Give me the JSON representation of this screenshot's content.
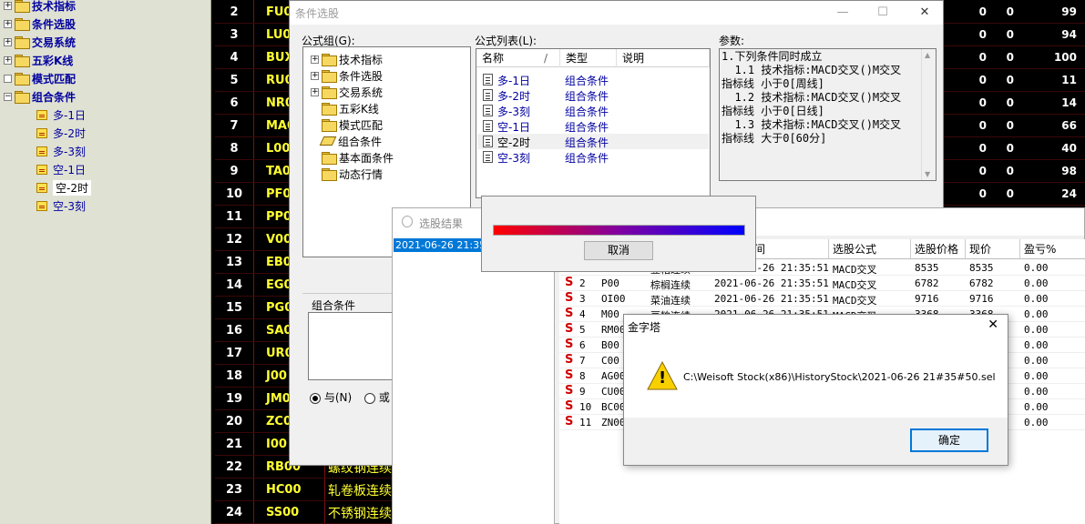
{
  "left_tree": {
    "items": [
      {
        "label": "技术指标",
        "type": "folder",
        "expander": "+"
      },
      {
        "label": "条件选股",
        "type": "folder",
        "expander": "+"
      },
      {
        "label": "交易系统",
        "type": "folder",
        "expander": "+"
      },
      {
        "label": "五彩K线",
        "type": "folder",
        "expander": "+"
      },
      {
        "label": "模式匹配",
        "type": "folder",
        "expander": ""
      },
      {
        "label": "组合条件",
        "type": "folder",
        "expander": "−"
      },
      {
        "label": "多-1日",
        "type": "leaf"
      },
      {
        "label": "多-2时",
        "type": "leaf"
      },
      {
        "label": "多-3刻",
        "type": "leaf"
      },
      {
        "label": "空-1日",
        "type": "leaf"
      },
      {
        "label": "空-2时",
        "type": "leaf",
        "selected": true
      },
      {
        "label": "空-3刻",
        "type": "leaf"
      }
    ]
  },
  "quote_table": {
    "rows": [
      {
        "num": "2",
        "code": "FU0",
        "name": "",
        "c1": "0",
        "c2": "0",
        "c3": "99"
      },
      {
        "num": "3",
        "code": "LU0",
        "name": "",
        "c1": "0",
        "c2": "0",
        "c3": "94"
      },
      {
        "num": "4",
        "code": "BUX",
        "name": "",
        "c1": "0",
        "c2": "0",
        "c3": "100"
      },
      {
        "num": "5",
        "code": "RU0",
        "name": "",
        "c1": "0",
        "c2": "0",
        "c3": "11"
      },
      {
        "num": "6",
        "code": "NR0",
        "name": "",
        "c1": "0",
        "c2": "0",
        "c3": "14"
      },
      {
        "num": "7",
        "code": "MA0",
        "name": "",
        "c1": "0",
        "c2": "0",
        "c3": "66"
      },
      {
        "num": "8",
        "code": "L00",
        "name": "",
        "c1": "0",
        "c2": "0",
        "c3": "40"
      },
      {
        "num": "9",
        "code": "TA00",
        "name": "",
        "c1": "0",
        "c2": "0",
        "c3": "98"
      },
      {
        "num": "10",
        "code": "PF00",
        "name": "",
        "c1": "0",
        "c2": "0",
        "c3": "24"
      },
      {
        "num": "11",
        "code": "PP0",
        "name": "",
        "c1": "",
        "c2": "",
        "c3": ""
      },
      {
        "num": "12",
        "code": "V00",
        "name": "",
        "c1": "",
        "c2": "",
        "c3": ""
      },
      {
        "num": "13",
        "code": "EB0",
        "name": "",
        "c1": "",
        "c2": "",
        "c3": ""
      },
      {
        "num": "14",
        "code": "EG0",
        "name": "",
        "c1": "",
        "c2": "",
        "c3": ""
      },
      {
        "num": "15",
        "code": "PG0",
        "name": "",
        "c1": "",
        "c2": "",
        "c3": ""
      },
      {
        "num": "16",
        "code": "SA0",
        "name": "",
        "c1": "",
        "c2": "",
        "c3": ""
      },
      {
        "num": "17",
        "code": "UR0",
        "name": "",
        "c1": "",
        "c2": "",
        "c3": ""
      },
      {
        "num": "18",
        "code": "J00",
        "name": "",
        "c1": "",
        "c2": "",
        "c3": ""
      },
      {
        "num": "19",
        "code": "JM0",
        "name": "",
        "c1": "",
        "c2": "",
        "c3": ""
      },
      {
        "num": "20",
        "code": "ZC0",
        "name": "",
        "c1": "",
        "c2": "",
        "c3": ""
      },
      {
        "num": "21",
        "code": "I00",
        "name": "",
        "c1": "",
        "c2": "",
        "c3": ""
      },
      {
        "num": "22",
        "code": "RB00",
        "name": "螺纹钢连续",
        "c1": "",
        "c2": "",
        "c3": ""
      },
      {
        "num": "23",
        "code": "HC00",
        "name": "轧卷板连续",
        "c1": "",
        "c2": "",
        "c3": ""
      },
      {
        "num": "24",
        "code": "SS00",
        "name": "不锈钢连续",
        "c1": "",
        "c2": "",
        "c3": ""
      }
    ]
  },
  "cond_window": {
    "title": "条件选股",
    "min_btn": "—",
    "max_btn": "☐",
    "close_btn": "✕",
    "group_label": "公式组(G):",
    "group_tree": [
      {
        "label": "技术指标",
        "expander": "+",
        "icon": "folder"
      },
      {
        "label": "条件选股",
        "expander": "+",
        "icon": "folder"
      },
      {
        "label": "交易系统",
        "expander": "+",
        "icon": "folder"
      },
      {
        "label": "五彩K线",
        "expander": "",
        "icon": "folder"
      },
      {
        "label": "模式匹配",
        "expander": "",
        "icon": "folder"
      },
      {
        "label": "组合条件",
        "expander": "",
        "icon": "pencil"
      },
      {
        "label": "基本面条件",
        "expander": "",
        "icon": "folder"
      },
      {
        "label": "动态行情",
        "expander": "",
        "icon": "folder"
      }
    ],
    "formula_label": "公式列表(L):",
    "formula_headers": {
      "name": "名称",
      "sort": "/",
      "type": "类型",
      "desc": "说明"
    },
    "formulas": [
      {
        "name": "多-1日",
        "type": "组合条件"
      },
      {
        "name": "多-2时",
        "type": "组合条件"
      },
      {
        "name": "多-3刻",
        "type": "组合条件"
      },
      {
        "name": "空-1日",
        "type": "组合条件"
      },
      {
        "name": "空-2时",
        "type": "组合条件",
        "selected": true
      },
      {
        "name": "空-3刻",
        "type": "组合条件"
      }
    ],
    "params_label": "参数:",
    "params_lines": [
      "1.下列条件同时成立",
      "  1.1 技术指标:MACD交叉()M交叉",
      "指标线 小于0[周线]",
      "  1.2 技术指标:MACD交叉()M交叉",
      "指标线 小于0[日线]",
      "  1.3 技术指标:MACD交叉()M交叉",
      "指标线 大于0[60分]"
    ],
    "combo_label": "组合条件",
    "radio_and": "与(N)",
    "radio_or": "或"
  },
  "result_window": {
    "title": "选股结果",
    "list_item": "2021-06-26 21:35",
    "headers": [
      "选股公式",
      "选股价格",
      "现价",
      "盈亏%"
    ],
    "header_partial": "间",
    "rows": [
      {
        "s": "S",
        "n": "",
        "code": "",
        "name": "豆粕连续",
        "time": "2021-06-26 21:35:51",
        "formula": "MACD交叉",
        "price": "8535",
        "cur": "8535",
        "pl": "0.00"
      },
      {
        "s": "S",
        "n": "2",
        "code": "P00",
        "name": "棕榈连续",
        "time": "2021-06-26 21:35:51",
        "formula": "MACD交叉",
        "price": "6782",
        "cur": "6782",
        "pl": "0.00"
      },
      {
        "s": "S",
        "n": "3",
        "code": "OI00",
        "name": "菜油连续",
        "time": "2021-06-26 21:35:51",
        "formula": "MACD交叉",
        "price": "9716",
        "cur": "9716",
        "pl": "0.00"
      },
      {
        "s": "S",
        "n": "4",
        "code": "M00",
        "name": "豆粕连续",
        "time": "2021-06-26 21:35:51",
        "formula": "MACD交叉",
        "price": "3368",
        "cur": "3368",
        "pl": "0.00"
      },
      {
        "s": "S",
        "n": "5",
        "code": "RM00",
        "name": "",
        "time": "",
        "formula": "",
        "price": "",
        "cur": "",
        "pl": "0.00"
      },
      {
        "s": "S",
        "n": "6",
        "code": "B00",
        "name": "",
        "time": "",
        "formula": "",
        "price": "",
        "cur": "",
        "pl": "0.00"
      },
      {
        "s": "S",
        "n": "7",
        "code": "C00",
        "name": "",
        "time": "",
        "formula": "",
        "price": "",
        "cur": "",
        "pl": "0.00"
      },
      {
        "s": "S",
        "n": "8",
        "code": "AG00",
        "name": "",
        "time": "",
        "formula": "",
        "price": "",
        "cur": "",
        "pl": "0.00"
      },
      {
        "s": "S",
        "n": "9",
        "code": "CU00",
        "name": "",
        "time": "",
        "formula": "",
        "price": "",
        "cur": "",
        "pl": "0.00"
      },
      {
        "s": "S",
        "n": "10",
        "code": "BC00",
        "name": "",
        "time": "",
        "formula": "",
        "price": "",
        "cur": "",
        "pl": "0.00"
      },
      {
        "s": "S",
        "n": "11",
        "code": "ZN00",
        "name": "",
        "time": "",
        "formula": "",
        "price": "",
        "cur": "",
        "pl": "0.00"
      }
    ]
  },
  "progress_popup": {
    "cancel_label": "取消",
    "progress": 1.0
  },
  "alert_dialog": {
    "title": "金字塔",
    "close_btn": "✕",
    "message": "C:\\Weisoft Stock(x86)\\HistoryStock\\2021-06-26 21#35#50.sel",
    "warning_glyph": "!",
    "ok_label": "确定"
  },
  "colors": {
    "quote_code": "#ffff30",
    "formula_link": "#0000a0",
    "sell_marker": "#d00000",
    "progress_start": "#ff0000",
    "progress_end": "#0000ff",
    "warning_icon": "#f8d000"
  }
}
